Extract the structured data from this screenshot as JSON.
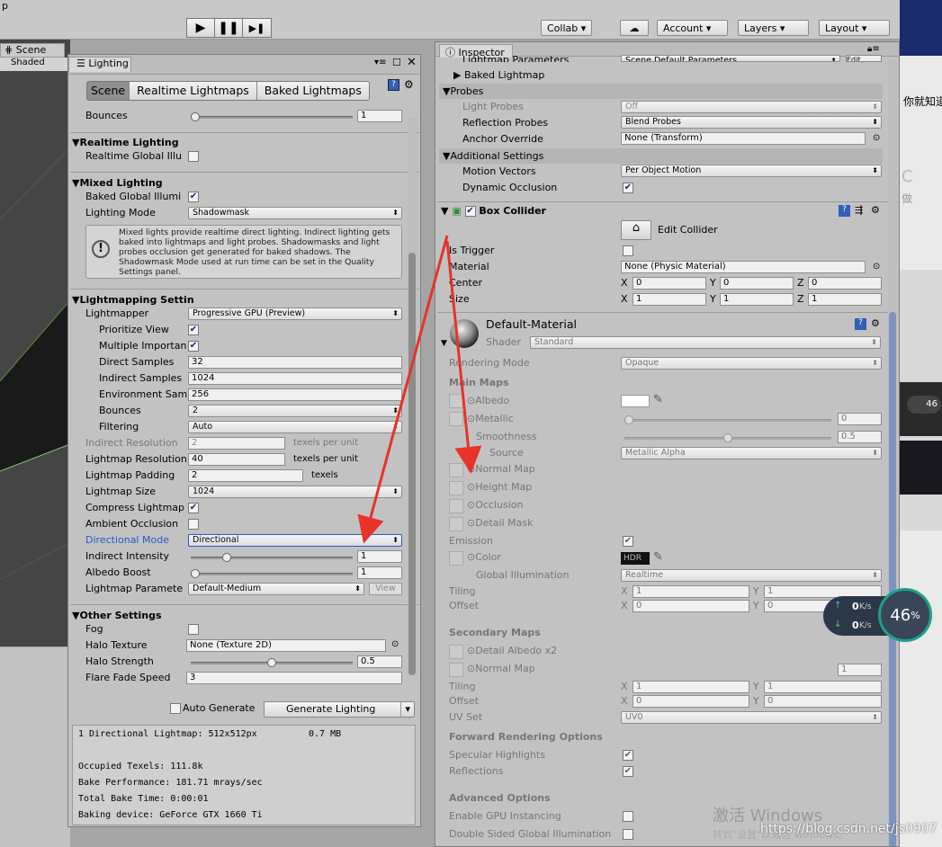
{
  "top": {
    "p": "p",
    "collab": "Collab ▾",
    "account": "Account ▾",
    "layers": "Layers ▾",
    "layout": "Layout ▾",
    "play": "▶",
    "pause": "❚❚",
    "step": "▶❚"
  },
  "scene": {
    "tab": "Scene",
    "shaded": "Shaded"
  },
  "lighting": {
    "tab": "Lighting",
    "tabs": [
      "Scene",
      "Realtime Lightmaps",
      "Baked Lightmaps"
    ],
    "bounces_top_label": "Bounces",
    "bounces_top_value": "1",
    "realtime_header": "Realtime Lighting",
    "realtime_gi": "Realtime Global Illu",
    "mixed_header": "Mixed Lighting",
    "baked_gi": "Baked Global Illumi",
    "lighting_mode": "Lighting Mode",
    "lighting_mode_value": "Shadowmask",
    "info": "Mixed lights provide realtime direct lighting. Indirect lighting gets baked into lightmaps and light probes. Shadowmasks and light probes occlusion get generated for baked shadows. The Shadowmask Mode used at run time can be set in the Quality Settings panel.",
    "lm_header": "Lightmapping Settin",
    "lightmapper": "Lightmapper",
    "lightmapper_value": "Progressive GPU (Preview)",
    "prioritize": "Prioritize View",
    "multiple": "Multiple Importan",
    "direct": "Direct Samples",
    "direct_value": "32",
    "indirect": "Indirect Samples",
    "indirect_value": "1024",
    "env": "Environment Sam",
    "env_value": "256",
    "bounces": "Bounces",
    "bounces_value": "2",
    "filtering": "Filtering",
    "filtering_value": "Auto",
    "ind_res": "Indirect Resolution",
    "ind_res_value": "2",
    "ind_res_units": "texels per unit",
    "lm_res": "Lightmap Resolution",
    "lm_res_value": "40",
    "lm_res_units": "texels per unit",
    "lm_pad": "Lightmap Padding",
    "lm_pad_value": "2",
    "lm_pad_units": "texels",
    "lm_size": "Lightmap Size",
    "lm_size_value": "1024",
    "compress": "Compress Lightmap",
    "ao": "Ambient Occlusion",
    "dir_mode": "Directional Mode",
    "dir_mode_value": "Directional",
    "ind_int": "Indirect Intensity",
    "ind_int_value": "1",
    "albedo": "Albedo Boost",
    "albedo_value": "1",
    "lm_params": "Lightmap Paramete",
    "lm_params_value": "Default-Medium",
    "view": "View",
    "other_header": "Other Settings",
    "fog": "Fog",
    "halo_tex": "Halo Texture",
    "halo_tex_value": "None (Texture 2D)",
    "halo_str": "Halo Strength",
    "halo_str_value": "0.5",
    "flare": "Flare Fade Speed",
    "flare_value": "3",
    "auto": "Auto Generate",
    "generate": "Generate Lighting",
    "stats": [
      "1 Directional Lightmap: 512x512px",
      "0.7 MB",
      "Occupied Texels: 111.8k",
      "Bake Performance: 181.71 mrays/sec",
      "Total Bake Time: 0:00:01",
      "Baking device: GeForce GTX 1660 Ti"
    ],
    "sliders": {
      "bounces_top": 0.0,
      "ind_int": 0.2,
      "albedo": 0.0,
      "halo_str": 0.5
    }
  },
  "inspector": {
    "tab": "Inspector",
    "lm_params": "Lightmap Parameters",
    "lm_params_value": "Scene Default Parameters",
    "edit": "Edit...",
    "baked_lm": "Baked Lightmap",
    "probes": "Probes",
    "light_probes": "Light Probes",
    "light_probes_value": "Off",
    "refl_probes": "Reflection Probes",
    "refl_probes_value": "Blend Probes",
    "anchor": "Anchor Override",
    "anchor_value": "None (Transform)",
    "additional": "Additional Settings",
    "motion": "Motion Vectors",
    "motion_value": "Per Object Motion",
    "dyn_occ": "Dynamic Occlusion",
    "box": "Box Collider",
    "edit_collider": "Edit Collider",
    "trigger": "Is Trigger",
    "material": "Material",
    "material_value": "None (Physic Material)",
    "center": "Center",
    "center_xyz": [
      "0",
      "0",
      "0"
    ],
    "size": "Size",
    "size_xyz": [
      "1",
      "1",
      "1"
    ],
    "mat_name": "Default-Material",
    "shader": "Shader",
    "shader_value": "Standard",
    "render_mode": "Rendering Mode",
    "render_mode_value": "Opaque",
    "main_maps": "Main Maps",
    "albedo": "Albedo",
    "metallic": "Metallic",
    "metallic_value": "0",
    "smooth": "Smoothness",
    "smooth_value": "0.5",
    "source": "Source",
    "source_value": "Metallic Alpha",
    "normal": "Normal Map",
    "height": "Height Map",
    "occlusion": "Occlusion",
    "detail": "Detail Mask",
    "emission": "Emission",
    "color": "Color",
    "hdr": "HDR",
    "gi": "Global Illumination",
    "gi_value": "Realtime",
    "tiling": "Tiling",
    "offset": "Offset",
    "tiling_xy": [
      "1",
      "1"
    ],
    "offset_xy": [
      "0",
      "0"
    ],
    "secondary": "Secondary Maps",
    "detail_albedo": "Detail Albedo x2",
    "normal2": "Normal Map",
    "normal2_value": "1",
    "tiling2": "Tiling",
    "offset2": "Offset",
    "tiling2_xy": [
      "1",
      "1"
    ],
    "offset2_xy": [
      "0",
      "0"
    ],
    "uv": "UV Set",
    "uv_value": "UV0",
    "forward": "Forward Rendering Options",
    "spec": "Specular Highlights",
    "refl": "Reflections",
    "advanced": "Advanced Options",
    "gpu": "Enable GPU Instancing",
    "double": "Double Sided Global Illumination",
    "sliders": {
      "metallic": 0.0,
      "smooth": 0.5
    }
  },
  "overlay": {
    "right_text": "你就知道",
    "c": "C",
    "zuo": "做",
    "net_up": "0",
    "net_down": "0",
    "net_unit": "K/s",
    "pct": "46",
    "pct_sign": "%",
    "mini_pct": "46",
    "watermark": "激活 Windows",
    "watermark2": "转到\"设置\"以激活 Windows。",
    "csdn": "https://blog.csdn.net/js0907"
  },
  "colors": {
    "accent": "#2a57c8",
    "arrow": "#e8322a"
  }
}
